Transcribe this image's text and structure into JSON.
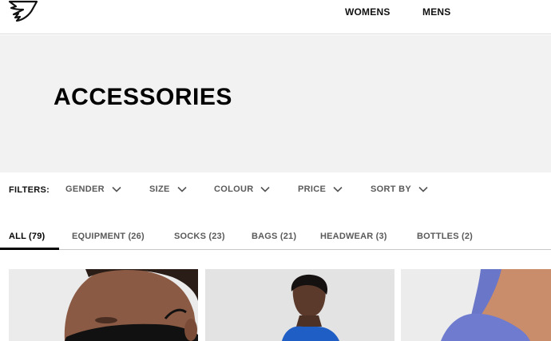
{
  "header": {
    "nav": [
      "WOMENS",
      "MENS"
    ]
  },
  "hero": {
    "title": "ACCESSORIES"
  },
  "filters": {
    "label": "FILTERS:",
    "items": [
      "GENDER",
      "SIZE",
      "COLOUR",
      "PRICE",
      "SORT BY"
    ]
  },
  "tabs": [
    {
      "label": "ALL (79)",
      "active": true
    },
    {
      "label": "EQUIPMENT (26)",
      "active": false
    },
    {
      "label": "SOCKS (23)",
      "active": false
    },
    {
      "label": "BAGS (21)",
      "active": false
    },
    {
      "label": "HEADWEAR (3)",
      "active": false
    },
    {
      "label": "BOTTLES (2)",
      "active": false
    }
  ],
  "products": [
    {
      "image": "man-wearing-black-face-mask"
    },
    {
      "image": "man-in-blue-hoodie"
    },
    {
      "image": "woman-in-blue-sports-bra"
    }
  ],
  "colors": {
    "hero_bg": "#f2f2f2",
    "accent": "#000000",
    "muted_text": "#5a5a5a"
  }
}
